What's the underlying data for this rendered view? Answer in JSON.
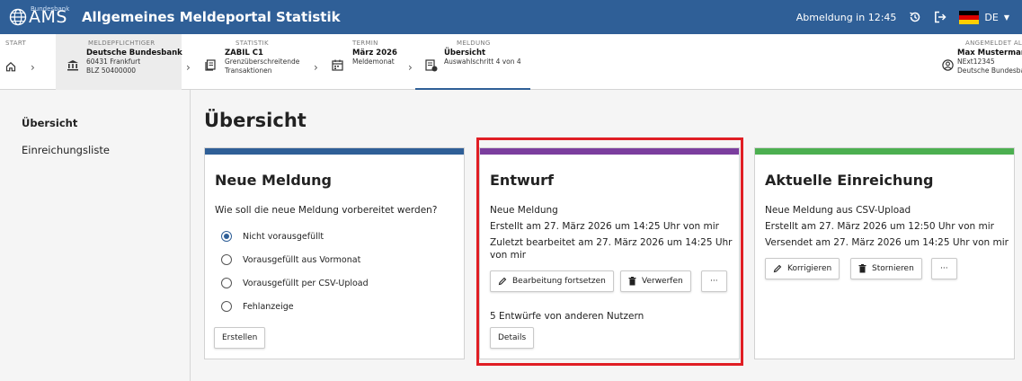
{
  "colors": {
    "brand": "#2f5f97",
    "neue_bar": "#2f5f97",
    "entwurf_bar": "#7b3e9e",
    "aktuell_bar": "#4caf50",
    "highlight": "#e01e24"
  },
  "header": {
    "logo_small": "Bundesbank",
    "logo_big": "AMS",
    "title": "Allgemeines Meldeportal Statistik",
    "session": "Abmeldung in 12:45",
    "lang": "DE"
  },
  "stepper": {
    "start": {
      "caption": "START"
    },
    "meldepflichtiger": {
      "caption": "MELDEPFLICHTIGER",
      "name": "Deutsche Bundesbank",
      "line2": "60431 Frankfurt",
      "line3": "BLZ 50400000"
    },
    "statistik": {
      "caption": "STATISTIK",
      "name": "ZABIL C1",
      "line2": "Grenzüberschreitende",
      "line3": "Transaktionen"
    },
    "termin": {
      "caption": "TERMIN",
      "name": "März 2026",
      "line2": "Meldemonat"
    },
    "meldung": {
      "caption": "MELDUNG",
      "name": "Übersicht",
      "line2": "Auswahlschritt 4 von 4"
    },
    "user": {
      "caption": "ANGEMELDET ALS",
      "name": "Max Mustermann",
      "line2": "NExt12345",
      "line3": "Deutsche Bundesbank"
    }
  },
  "sidebar": {
    "items": [
      {
        "label": "Übersicht"
      },
      {
        "label": "Einreichungsliste"
      }
    ]
  },
  "main": {
    "title": "Übersicht",
    "neue": {
      "title": "Neue Meldung",
      "question": "Wie soll die neue Meldung vorbereitet werden?",
      "options": [
        "Nicht vorausgefüllt",
        "Vorausgefüllt aus Vormonat",
        "Vorausgefüllt per CSV-Upload",
        "Fehlanzeige"
      ],
      "selected": "Nicht vorausgefüllt",
      "create_label": "Erstellen"
    },
    "entwurf": {
      "title": "Entwurf",
      "line1": "Neue Meldung",
      "line2": "Erstellt am 27. März 2026 um 14:25 Uhr von mir",
      "line3a": "Zuletzt bearbeitet am 27. März 2026 um 14:25 Uhr",
      "line3b": "von mir",
      "continue_label": "Bearbeitung fortsetzen",
      "discard_label": "Verwerfen",
      "more_label": "···",
      "others": "5 Entwürfe von anderen Nutzern",
      "details_label": "Details"
    },
    "aktuell": {
      "title": "Aktuelle Einreichung",
      "line1": "Neue Meldung aus CSV-Upload",
      "line2": "Erstellt am 27. März 2026 um 12:50 Uhr von mir",
      "line3": "Versendet am 27. März 2026 um 14:25 Uhr von mir",
      "correct_label": "Korrigieren",
      "cancel_label": "Stornieren",
      "more_label": "···"
    }
  }
}
